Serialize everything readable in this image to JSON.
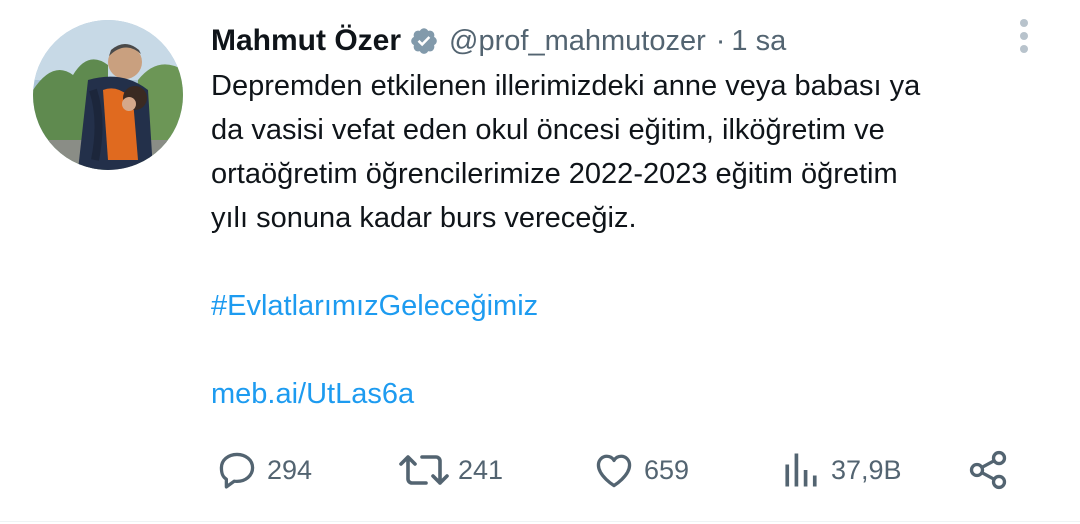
{
  "author": {
    "name": "Mahmut Özer",
    "handle": "@prof_mahmutozer",
    "separator": "·",
    "time": "1 sa",
    "verified": true
  },
  "tweet": {
    "lines": [
      "Depremden etkilenen illerimizdeki anne veya babası ya",
      "da vasisi vefat eden okul öncesi eğitim, ilköğretim ve",
      "ortaöğretim öğrencilerimize 2022-2023 eğitim öğretim",
      "yılı sonuna kadar burs vereceğiz."
    ],
    "hashtag": "#EvlatlarımızGeleceğimiz",
    "link": "meb.ai/UtLas6a"
  },
  "actions": {
    "replies": "294",
    "retweets": "241",
    "likes": "659",
    "views": "37,9B"
  },
  "colors": {
    "accent": "#1d9bf0",
    "text": "#0f1419",
    "secondary": "#536471",
    "verified_badge": "#829aab"
  },
  "icons": {
    "reply": "speech-bubble-icon",
    "retweet": "retweet-arrows-icon",
    "like": "heart-icon",
    "views": "bar-chart-icon",
    "share": "share-nodes-icon",
    "more": "vertical-ellipsis-icon",
    "verified": "verified-badge-icon"
  }
}
